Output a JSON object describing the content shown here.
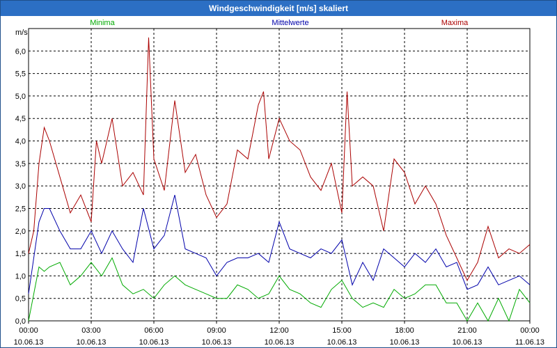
{
  "window": {
    "title": "Windgeschwindigkeit [m/s] skaliert"
  },
  "chart_data": {
    "type": "line",
    "title": "Windgeschwindigkeit [m/s] skaliert",
    "ylabel": "m/s",
    "xlabel": "",
    "ylim": [
      0,
      6.5
    ],
    "xlim_hours": [
      0,
      24
    ],
    "grid": true,
    "y_ticks": [
      "0,0",
      "0,5",
      "1,0",
      "1,5",
      "2,0",
      "2,5",
      "3,0",
      "3,5",
      "4,0",
      "4,5",
      "5,0",
      "5,5",
      "6,0"
    ],
    "x_ticks": [
      {
        "time": "00:00",
        "date": "10.06.13"
      },
      {
        "time": "03:00",
        "date": "10.06.13"
      },
      {
        "time": "06:00",
        "date": "10.06.13"
      },
      {
        "time": "09:00",
        "date": "10.06.13"
      },
      {
        "time": "12:00",
        "date": "10.06.13"
      },
      {
        "time": "15:00",
        "date": "10.06.13"
      },
      {
        "time": "18:00",
        "date": "10.06.13"
      },
      {
        "time": "21:00",
        "date": "10.06.13"
      },
      {
        "time": "00:00",
        "date": "11.06.13"
      }
    ],
    "series": [
      {
        "name": "Minima",
        "color": "#00aa00",
        "hours": [
          0.0,
          0.5,
          0.75,
          1.0,
          1.5,
          2.0,
          2.5,
          3.0,
          3.5,
          4.0,
          4.5,
          5.0,
          5.5,
          6.0,
          6.5,
          7.0,
          7.5,
          8.0,
          8.5,
          9.0,
          9.5,
          10.0,
          10.5,
          11.0,
          11.5,
          12.0,
          12.5,
          13.0,
          13.5,
          14.0,
          14.5,
          15.0,
          15.5,
          16.0,
          16.5,
          17.0,
          17.5,
          18.0,
          18.5,
          19.0,
          19.5,
          20.0,
          20.5,
          21.0,
          21.5,
          22.0,
          22.5,
          23.0,
          23.5,
          24.0
        ],
        "values": [
          0.0,
          1.2,
          1.1,
          1.2,
          1.3,
          0.8,
          1.0,
          1.3,
          1.0,
          1.4,
          0.8,
          0.6,
          0.7,
          0.5,
          0.8,
          1.0,
          0.8,
          0.7,
          0.6,
          0.5,
          0.5,
          0.8,
          0.7,
          0.5,
          0.6,
          1.0,
          0.7,
          0.6,
          0.4,
          0.3,
          0.7,
          0.9,
          0.5,
          0.3,
          0.4,
          0.3,
          0.7,
          0.5,
          0.6,
          0.8,
          0.8,
          0.4,
          0.4,
          0.0,
          0.4,
          0.0,
          0.5,
          0.0,
          0.7,
          0.4
        ]
      },
      {
        "name": "Mittelwerte",
        "color": "#0000aa",
        "hours": [
          0.0,
          0.5,
          0.75,
          1.0,
          1.5,
          2.0,
          2.5,
          3.0,
          3.5,
          4.0,
          4.5,
          5.0,
          5.5,
          6.0,
          6.5,
          7.0,
          7.5,
          8.0,
          8.5,
          9.0,
          9.5,
          10.0,
          10.5,
          11.0,
          11.5,
          12.0,
          12.5,
          13.0,
          13.5,
          14.0,
          14.5,
          15.0,
          15.5,
          16.0,
          16.5,
          17.0,
          17.5,
          18.0,
          18.5,
          19.0,
          19.5,
          20.0,
          20.5,
          21.0,
          21.5,
          22.0,
          22.5,
          23.0,
          23.5,
          24.0
        ],
        "values": [
          0.6,
          2.2,
          2.5,
          2.5,
          2.0,
          1.6,
          1.6,
          2.0,
          1.5,
          2.0,
          1.6,
          1.3,
          2.5,
          1.6,
          1.9,
          2.8,
          1.6,
          1.5,
          1.4,
          1.0,
          1.3,
          1.4,
          1.4,
          1.5,
          1.3,
          2.2,
          1.6,
          1.5,
          1.4,
          1.6,
          1.5,
          1.8,
          0.8,
          1.3,
          0.9,
          1.6,
          1.4,
          1.2,
          1.5,
          1.3,
          1.6,
          1.2,
          1.3,
          0.7,
          0.8,
          1.2,
          0.8,
          0.9,
          1.0,
          0.8
        ]
      },
      {
        "name": "Maxima",
        "color": "#aa0000",
        "hours": [
          0.0,
          0.25,
          0.5,
          0.75,
          1.0,
          1.5,
          2.0,
          2.5,
          3.0,
          3.25,
          3.5,
          4.0,
          4.5,
          5.0,
          5.5,
          5.75,
          6.0,
          6.5,
          7.0,
          7.5,
          8.0,
          8.5,
          9.0,
          9.5,
          10.0,
          10.5,
          11.0,
          11.25,
          11.5,
          12.0,
          12.5,
          13.0,
          13.5,
          14.0,
          14.5,
          15.0,
          15.25,
          15.5,
          16.0,
          16.5,
          17.0,
          17.5,
          18.0,
          18.5,
          19.0,
          19.5,
          20.0,
          20.5,
          21.0,
          21.5,
          22.0,
          22.5,
          23.0,
          23.5,
          24.0
        ],
        "values": [
          1.5,
          2.0,
          3.5,
          4.3,
          4.0,
          3.2,
          2.4,
          2.8,
          2.2,
          4.0,
          3.5,
          4.5,
          3.0,
          3.3,
          2.8,
          6.3,
          3.6,
          2.9,
          4.9,
          3.3,
          3.7,
          2.8,
          2.3,
          2.6,
          3.8,
          3.6,
          4.8,
          5.1,
          3.6,
          4.5,
          4.0,
          3.8,
          3.2,
          2.9,
          3.5,
          2.4,
          5.1,
          3.0,
          3.2,
          3.0,
          2.0,
          3.6,
          3.3,
          2.6,
          3.0,
          2.6,
          1.9,
          1.4,
          0.9,
          1.3,
          2.1,
          1.4,
          1.6,
          1.5,
          1.7
        ]
      }
    ]
  }
}
